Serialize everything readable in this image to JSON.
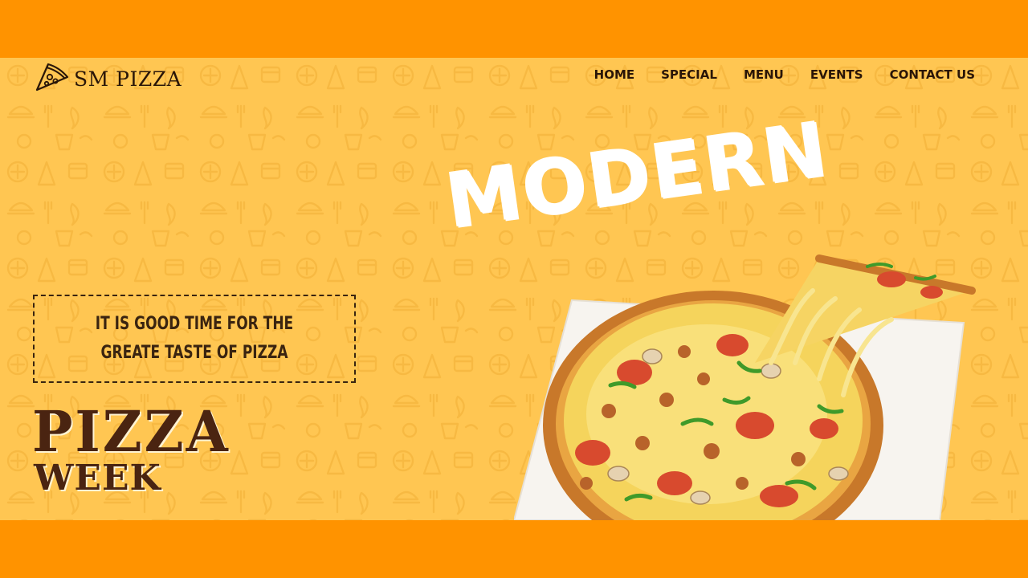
{
  "brand": {
    "name": "SM PIZZA",
    "logo_icon": "pizza-slice-icon"
  },
  "nav": {
    "items": [
      {
        "label": "HOME"
      },
      {
        "label": "SPECIAL"
      },
      {
        "label": "MENU"
      },
      {
        "label": "EVENTS"
      },
      {
        "label": "CONTACT US"
      }
    ]
  },
  "hero": {
    "headline": "MODERN",
    "tagline": "IT IS GOOD TIME FOR THE GREATE TASTE OF PIZZA",
    "promo_line1": "PIZZA",
    "promo_line2": "WEEK"
  },
  "colors": {
    "frame": "#ff9300",
    "background": "#ffc652",
    "text_dark": "#2a1608",
    "headline": "#ffffff",
    "promo": "#4a2411"
  }
}
